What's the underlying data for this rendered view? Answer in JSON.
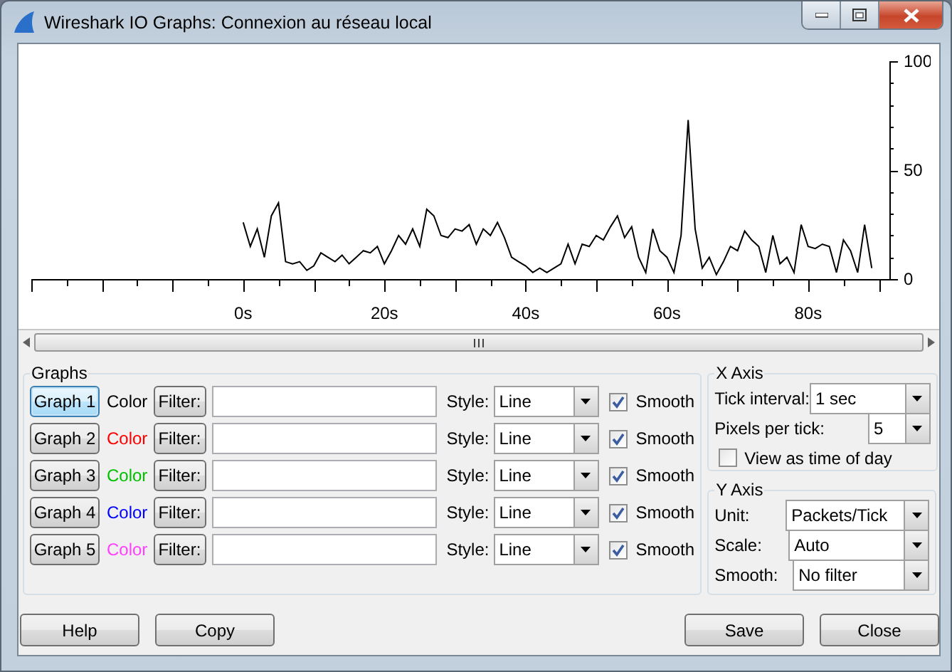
{
  "window": {
    "title": "Wireshark IO Graphs: Connexion au réseau local"
  },
  "chart": {
    "chart_data": {
      "type": "line",
      "x": [
        0,
        1,
        2,
        3,
        4,
        5,
        6,
        7,
        8,
        9,
        10,
        11,
        12,
        13,
        14,
        15,
        16,
        17,
        18,
        19,
        20,
        21,
        22,
        23,
        24,
        25,
        26,
        27,
        28,
        29,
        30,
        31,
        32,
        33,
        34,
        35,
        36,
        37,
        38,
        39,
        40,
        41,
        42,
        43,
        44,
        45,
        46,
        47,
        48,
        49,
        50,
        51,
        52,
        53,
        54,
        55,
        56,
        57,
        58,
        59,
        60,
        61,
        62,
        63,
        64,
        65,
        66,
        67,
        68,
        69,
        70,
        71,
        72,
        73,
        74,
        75,
        76,
        77,
        78,
        79,
        80,
        81,
        82,
        83,
        84,
        85,
        86,
        87,
        88,
        89
      ],
      "series": [
        {
          "color": "#000000",
          "values": [
            26,
            15,
            23,
            10,
            29,
            35,
            8,
            7,
            8,
            4,
            6,
            12,
            10,
            8,
            11,
            7,
            10,
            13,
            12,
            15,
            7,
            13,
            20,
            16,
            23,
            15,
            32,
            29,
            20,
            19,
            23,
            22,
            25,
            16,
            23,
            20,
            26,
            19,
            10,
            8,
            6,
            3,
            5,
            3,
            5,
            7,
            16,
            7,
            16,
            15,
            20,
            18,
            24,
            29,
            19,
            24,
            10,
            3,
            23,
            13,
            10,
            3,
            20,
            73,
            23,
            5,
            10,
            2,
            8,
            15,
            13,
            22,
            18,
            15,
            3,
            20,
            7,
            10,
            3,
            25,
            15,
            14,
            16,
            15,
            3,
            18,
            13,
            3,
            25,
            5
          ]
        }
      ],
      "xlim": [
        -30,
        91.5
      ],
      "ylim": [
        0,
        100
      ],
      "xticks": [
        {
          "value": 0,
          "label": "0s"
        },
        {
          "value": 20,
          "label": "20s"
        },
        {
          "value": 40,
          "label": "40s"
        },
        {
          "value": 60,
          "label": "60s"
        },
        {
          "value": 80,
          "label": "80s"
        }
      ],
      "yticks": [
        0,
        50,
        100
      ]
    }
  },
  "graphs": {
    "title": "Graphs",
    "rows": [
      {
        "button": "Graph 1",
        "selected": true,
        "color_label": "Color",
        "color": "#000000",
        "filter_button": "Filter:",
        "style_label": "Style:",
        "style": "Line",
        "smooth_label": "Smooth",
        "smooth": true
      },
      {
        "button": "Graph 2",
        "selected": false,
        "color_label": "Color",
        "color": "#ff0000",
        "filter_button": "Filter:",
        "style_label": "Style:",
        "style": "Line",
        "smooth_label": "Smooth",
        "smooth": true
      },
      {
        "button": "Graph 3",
        "selected": false,
        "color_label": "Color",
        "color": "#00c000",
        "filter_button": "Filter:",
        "style_label": "Style:",
        "style": "Line",
        "smooth_label": "Smooth",
        "smooth": true
      },
      {
        "button": "Graph 4",
        "selected": false,
        "color_label": "Color",
        "color": "#0000ff",
        "filter_button": "Filter:",
        "style_label": "Style:",
        "style": "Line",
        "smooth_label": "Smooth",
        "smooth": true
      },
      {
        "button": "Graph 5",
        "selected": false,
        "color_label": "Color",
        "color": "#ff40ff",
        "filter_button": "Filter:",
        "style_label": "Style:",
        "style": "Line",
        "smooth_label": "Smooth",
        "smooth": true
      }
    ]
  },
  "x_axis": {
    "title": "X Axis",
    "tick_interval": {
      "label": "Tick interval:",
      "value": "1 sec"
    },
    "pixels_per_tick": {
      "label": "Pixels per tick:",
      "value": "5"
    },
    "time_of_day": {
      "label": "View as time of day",
      "checked": false
    }
  },
  "y_axis": {
    "title": "Y Axis",
    "unit": {
      "label": "Unit:",
      "value": "Packets/Tick"
    },
    "scale": {
      "label": "Scale:",
      "value": "Auto"
    },
    "smooth": {
      "label": "Smooth:",
      "value": "No filter"
    }
  },
  "buttons": [
    {
      "label": "Help"
    },
    {
      "label": "Copy"
    },
    {
      "label": "Save"
    },
    {
      "label": "Close"
    }
  ]
}
